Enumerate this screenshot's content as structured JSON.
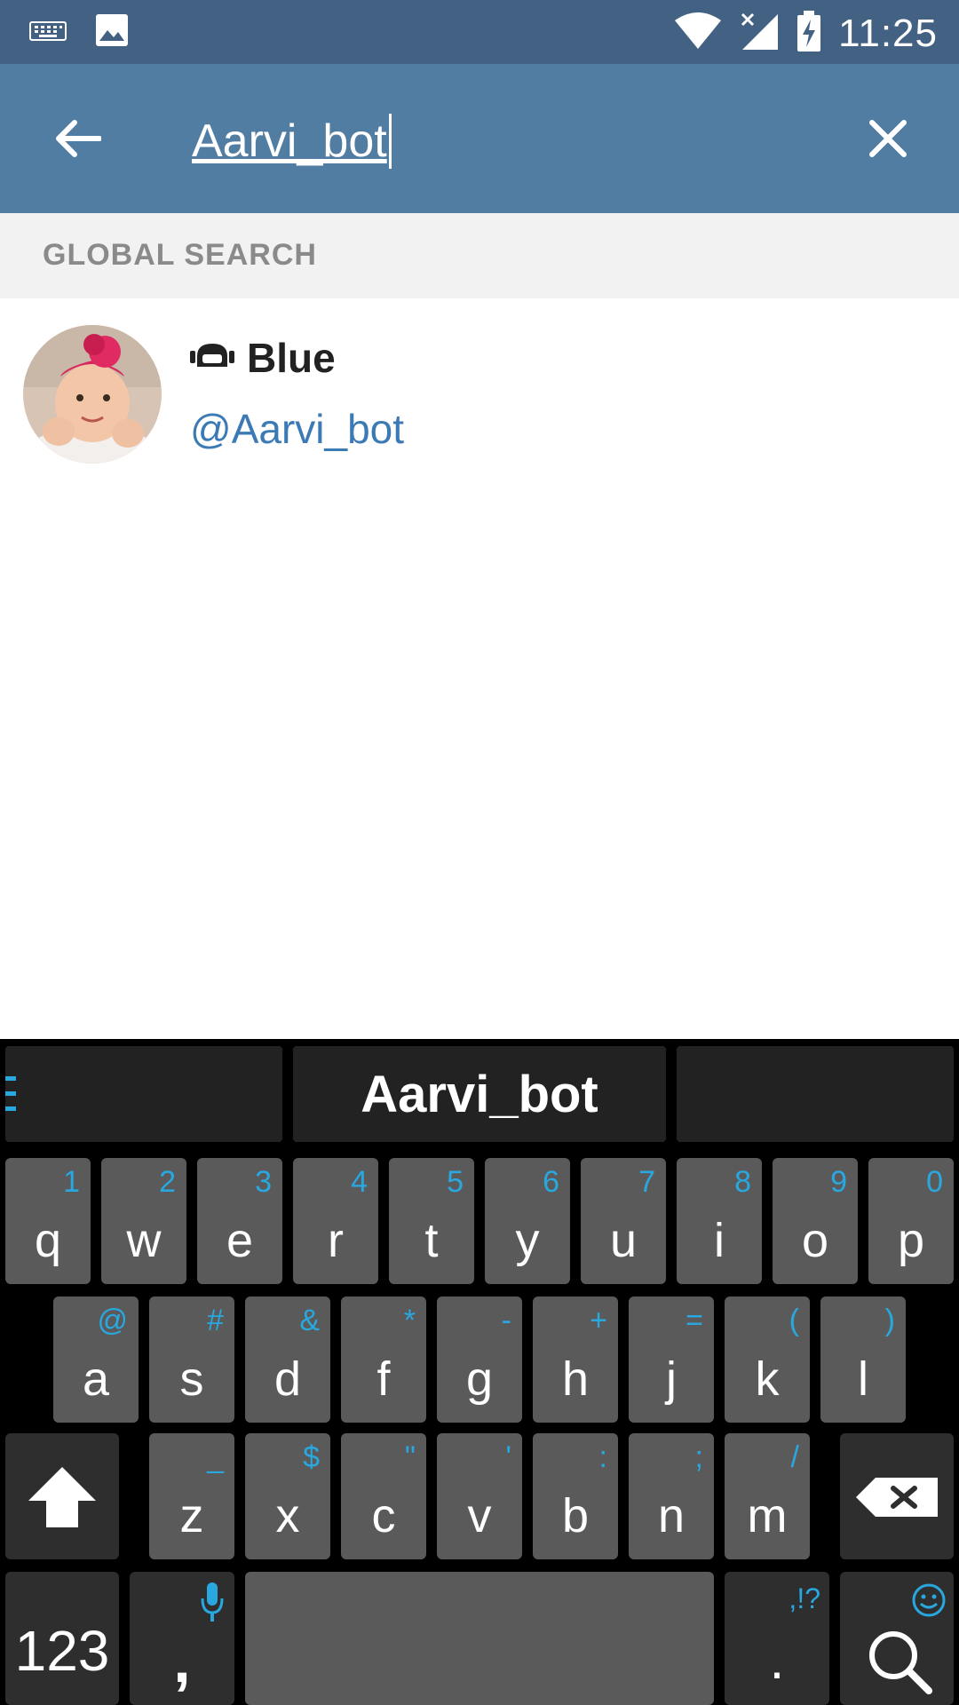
{
  "status_bar": {
    "time": "11:25",
    "icons": [
      "keyboard-icon",
      "image-icon",
      "wifi-icon",
      "signal-no-service-icon",
      "battery-charging-icon"
    ]
  },
  "app_bar": {
    "search_value": "Aarvi_bot",
    "back_icon": "arrow-back-icon",
    "clear_icon": "close-icon"
  },
  "section": {
    "title": "GLOBAL SEARCH"
  },
  "results": [
    {
      "name": "Blue",
      "username": "@Aarvi_bot",
      "bot_icon": "bot-icon"
    }
  ],
  "keyboard": {
    "suggestion": "Aarvi_bot",
    "row1": [
      {
        "k": "q",
        "s": "1"
      },
      {
        "k": "w",
        "s": "2"
      },
      {
        "k": "e",
        "s": "3"
      },
      {
        "k": "r",
        "s": "4"
      },
      {
        "k": "t",
        "s": "5"
      },
      {
        "k": "y",
        "s": "6"
      },
      {
        "k": "u",
        "s": "7"
      },
      {
        "k": "i",
        "s": "8"
      },
      {
        "k": "o",
        "s": "9"
      },
      {
        "k": "p",
        "s": "0"
      }
    ],
    "row2": [
      {
        "k": "a",
        "s": "@"
      },
      {
        "k": "s",
        "s": "#"
      },
      {
        "k": "d",
        "s": "&"
      },
      {
        "k": "f",
        "s": "*"
      },
      {
        "k": "g",
        "s": "-"
      },
      {
        "k": "h",
        "s": "+"
      },
      {
        "k": "j",
        "s": "="
      },
      {
        "k": "k",
        "s": "("
      },
      {
        "k": "l",
        "s": ")"
      }
    ],
    "row3": [
      {
        "k": "z",
        "s": "_"
      },
      {
        "k": "x",
        "s": "$"
      },
      {
        "k": "c",
        "s": "\""
      },
      {
        "k": "v",
        "s": "'"
      },
      {
        "k": "b",
        "s": ":"
      },
      {
        "k": "n",
        "s": ";"
      },
      {
        "k": "m",
        "s": "/"
      }
    ],
    "symbols_label": "123",
    "comma_label": ",",
    "period_label": ".",
    "period_sub": ",!?",
    "accent_color": "#29a8e0"
  }
}
